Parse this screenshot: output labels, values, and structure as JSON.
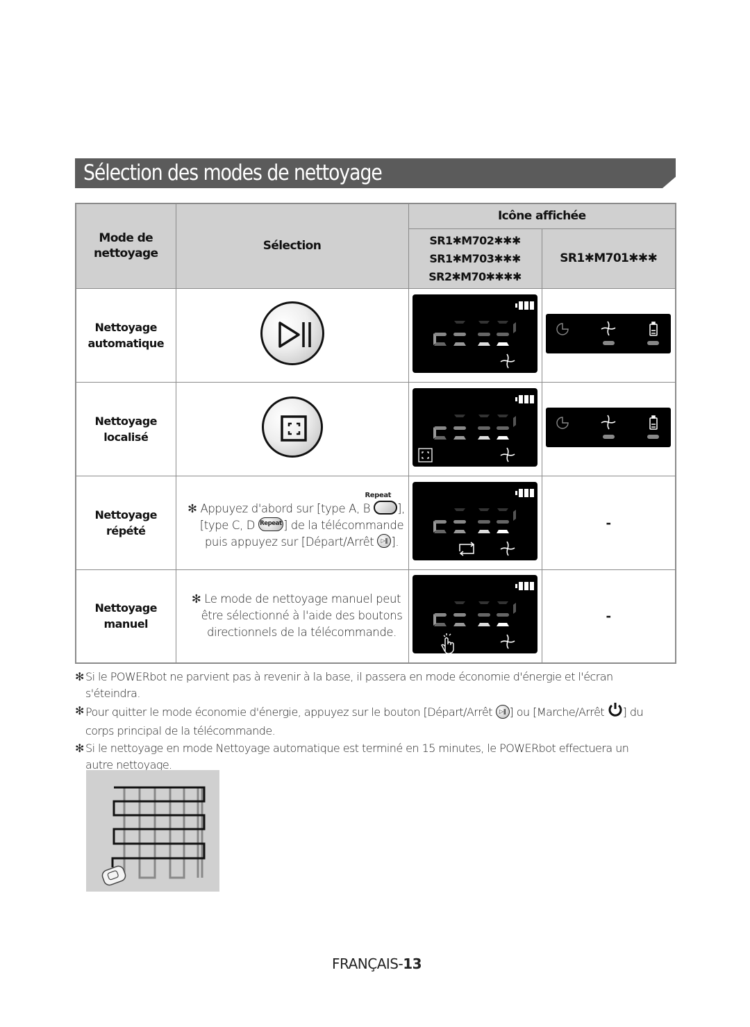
{
  "title": "Sélection des modes de nettoyage",
  "table": {
    "headers": {
      "mode": "Mode de nettoyage",
      "mode_line1": "Mode de",
      "mode_line2": "nettoyage",
      "selection": "Sélection",
      "icon_displayed": "Icône affichée",
      "models_group_a": [
        "SR1✱M702✱✱✱",
        "SR1✱M703✱✱✱",
        "SR2✱M70✱✱✱✱"
      ],
      "models_group_b": "SR1✱M701✱✱✱"
    },
    "rows": [
      {
        "mode_line1": "Nettoyage",
        "mode_line2": "automatique",
        "selection_icon": "play-pause-button-icon",
        "display_a_icons": [
          "battery-icon",
          "fan-icon"
        ],
        "display_b_icons": [
          "timer-icon",
          "fan-icon",
          "battery-icon"
        ]
      },
      {
        "mode_line1": "Nettoyage",
        "mode_line2": "localisé",
        "selection_icon": "spot-clean-button-icon",
        "display_a_icons": [
          "battery-icon",
          "spot-icon",
          "fan-icon"
        ],
        "display_b_icons": [
          "timer-icon",
          "fan-icon",
          "battery-icon"
        ]
      },
      {
        "mode_line1": "Nettoyage",
        "mode_line2": "répété",
        "note_mark": "✻",
        "repeat_label": "Repeat",
        "note_lines": [
          "Appuyez d'abord sur [type A, B",
          "],",
          "[type C, D",
          "] de la télécommande",
          "puis appuyez sur [Départ/Arrêt",
          "]."
        ],
        "display_a_icons": [
          "battery-icon",
          "repeat-icon",
          "fan-icon"
        ],
        "display_b": "-"
      },
      {
        "mode_line1": "Nettoyage",
        "mode_line2": "manuel",
        "note_mark": "✻",
        "note_lines": [
          "Le mode de nettoyage manuel peut",
          "être sélectionné à l'aide des boutons",
          "directionnels de la télécommande."
        ],
        "display_a_icons": [
          "battery-icon",
          "hand-touch-icon",
          "fan-icon"
        ],
        "display_b": "-"
      }
    ]
  },
  "footnotes": [
    {
      "mark": "✻",
      "line1": "Si le POWERbot ne parvient pas à revenir à la base, il passera en mode économie d'énergie et l'écran",
      "line2": "s'éteindra."
    },
    {
      "mark": "✻",
      "part1": "Pour quitter le mode économie d'énergie, appuyez sur le bouton [Départ/Arrêt ",
      "part2": "] ou [Marche/Arrêt ",
      "part3": "] du",
      "line2": "corps principal de la télécommande."
    },
    {
      "mark": "✻",
      "line1": "Si le nettoyage en mode Nettoyage automatique est terminé en 15 minutes, le POWERbot effectuera un",
      "line2": "autre nettoyage."
    }
  ],
  "illustration": "zigzag-cleaning-pattern",
  "page_number": {
    "lang": "FRANÇAIS-",
    "num": "13"
  },
  "colors": {
    "title_bar": "#5b5b5b",
    "header_bg": "#d0d0d0",
    "lcd_bg": "#000000",
    "border": "#8a8a8a"
  }
}
